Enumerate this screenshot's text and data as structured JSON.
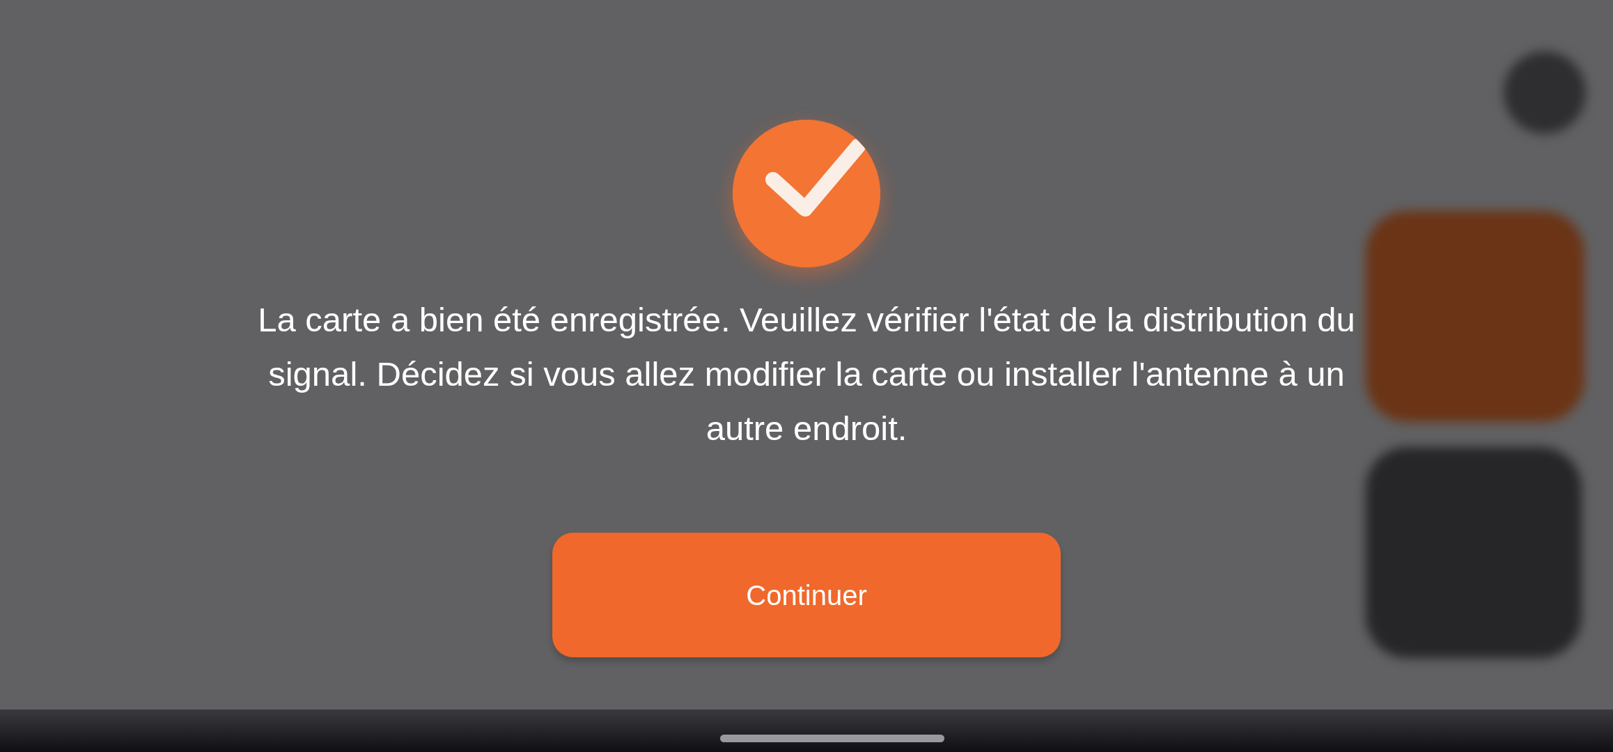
{
  "dialog": {
    "message": "La carte a bien été enregistrée. Veuillez vérifier l'état de la distribution du signal. Décidez si vous allez modifier la carte ou installer l'antenne à un autre endroit.",
    "button": "Continuer"
  }
}
